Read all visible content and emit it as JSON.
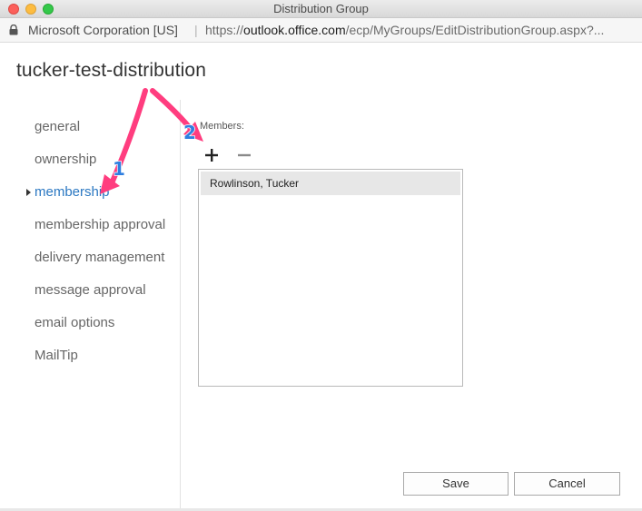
{
  "window": {
    "title": "Distribution Group"
  },
  "address_bar": {
    "certificate": "Microsoft Corporation [US]",
    "separator": "|",
    "url_prefix": "https://",
    "url_host": "outlook.office.com",
    "url_path": "/ecp/MyGroups/EditDistributionGroup.aspx?..."
  },
  "page": {
    "title": "tucker-test-distribution"
  },
  "nav": {
    "items": [
      {
        "label": "general"
      },
      {
        "label": "ownership"
      },
      {
        "label": "membership",
        "active": true
      },
      {
        "label": "membership approval"
      },
      {
        "label": "delivery management"
      },
      {
        "label": "message approval"
      },
      {
        "label": "email options"
      },
      {
        "label": "MailTip"
      }
    ]
  },
  "members": {
    "label": "Members:",
    "add_icon": "plus-icon",
    "remove_icon": "minus-icon",
    "list": [
      {
        "name": "Rowlinson, Tucker",
        "selected": true
      }
    ]
  },
  "footer": {
    "save_label": "Save",
    "cancel_label": "Cancel"
  },
  "annotations": {
    "badges": [
      "1",
      "2"
    ],
    "color": "#ff3d7f",
    "badge_fill": "#2f7fe0"
  },
  "colors": {
    "active_nav": "#2b78c2",
    "selected_row": "#e7e7e7"
  }
}
